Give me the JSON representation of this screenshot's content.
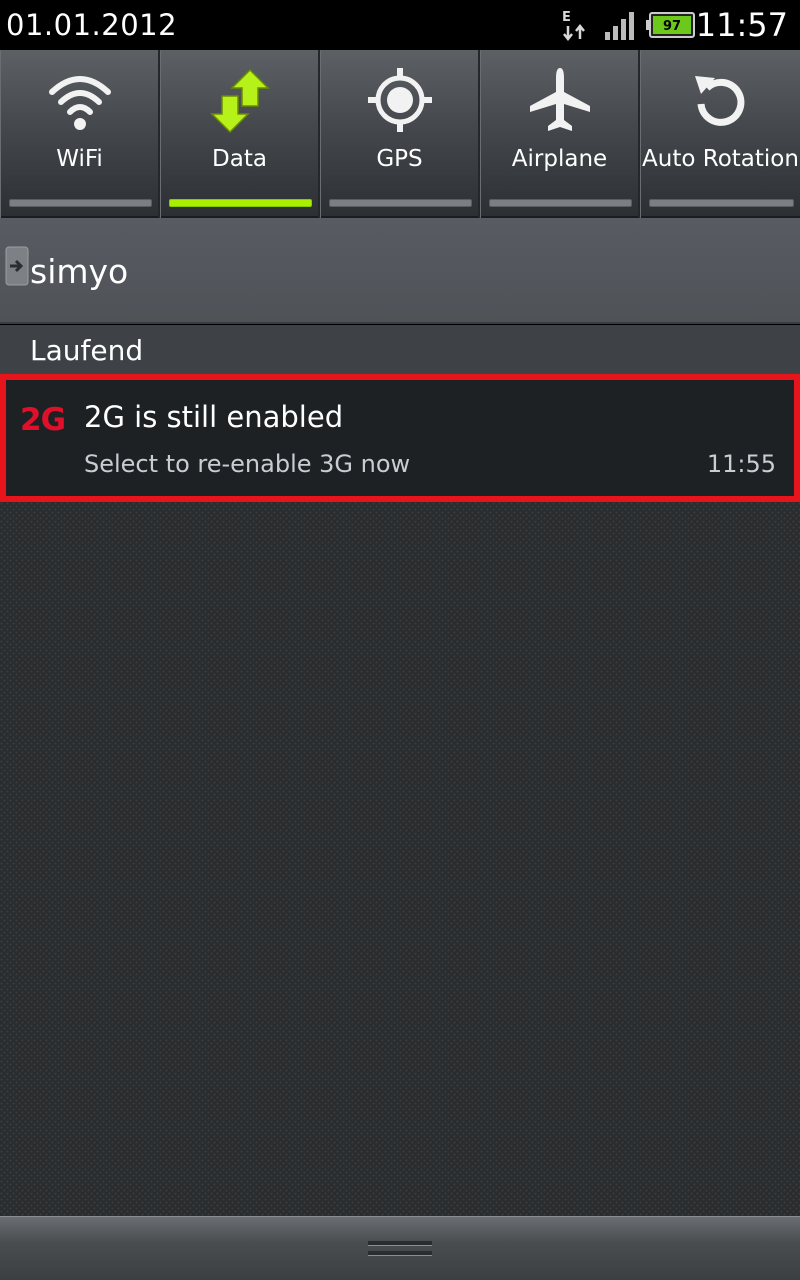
{
  "status_bar": {
    "date": "01.01.2012",
    "time": "11:57",
    "network_type": "E",
    "battery_level": "97",
    "icons": [
      "data-activity-icon",
      "signal-icon",
      "battery-icon"
    ]
  },
  "quick_toggles": [
    {
      "label": "WiFi",
      "icon": "wifi-icon",
      "active": false
    },
    {
      "label": "Data",
      "icon": "data-arrows-icon",
      "active": true
    },
    {
      "label": "GPS",
      "icon": "gps-icon",
      "active": false
    },
    {
      "label": "Airplane",
      "icon": "airplane-icon",
      "active": false
    },
    {
      "label": "Auto Rotation",
      "icon": "rotation-icon",
      "active": false
    }
  ],
  "colors": {
    "active_indicator": "#a8f000",
    "highlight_border": "#e8141c",
    "notification_icon": "#e0102a"
  },
  "operator": {
    "name": "simyo",
    "icon": "sim-icon"
  },
  "ongoing_section": {
    "title": "Laufend"
  },
  "notification": {
    "icon_text": "2G",
    "title": "2G is still enabled",
    "text": "Select to re-enable 3G now",
    "time": "11:55"
  },
  "handle": {
    "icon": "drag-handle-icon"
  }
}
